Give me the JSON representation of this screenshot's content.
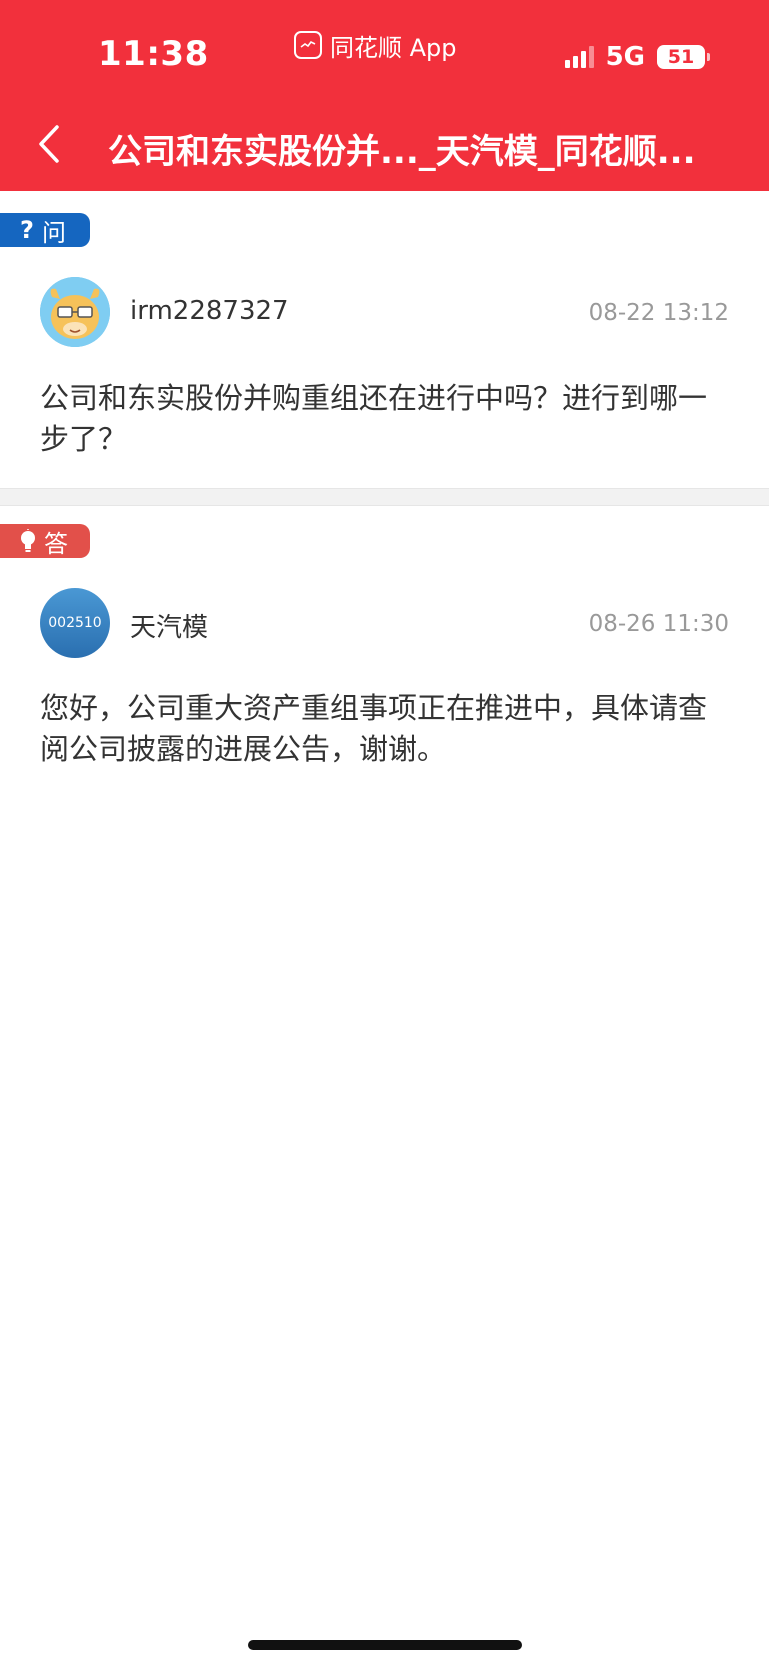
{
  "status_bar": {
    "time": "11:38",
    "app_name": "同花顺 App",
    "network": "5G",
    "battery": "51"
  },
  "nav": {
    "title": "公司和东实股份并..._天汽模_同花顺..."
  },
  "question": {
    "tag": "问",
    "username": "irm2287327",
    "time": "08-22 13:12",
    "content": "公司和东实股份并购重组还在进行中吗？进行到哪一步了？"
  },
  "answer": {
    "tag": "答",
    "username": "天汽模",
    "avatar_text": "002510",
    "time": "08-26 11:30",
    "content": "您好，公司重大资产重组事项正在推进中，具体请查阅公司披露的进展公告，谢谢。"
  },
  "colors": {
    "header_bg": "#f2303c",
    "ask_tag": "#1566c0",
    "answer_tag": "#e2504a"
  }
}
